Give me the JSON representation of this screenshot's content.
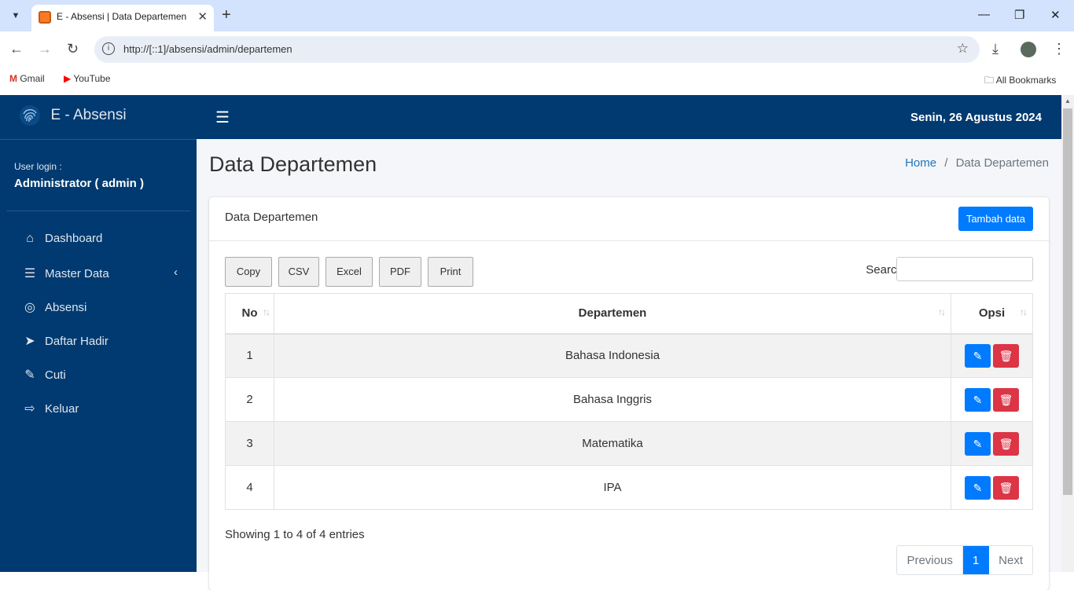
{
  "browser": {
    "tab_title": "E - Absensi | Data Departemen",
    "url": "http://[::1]/absensi/admin/departemen",
    "bookmarks": [
      {
        "label": "Gmail",
        "icon": "gmail-icon"
      },
      {
        "label": "YouTube",
        "icon": "youtube-icon"
      }
    ],
    "all_bookmarks": "All Bookmarks"
  },
  "sidebar": {
    "brand": "E - Absensi",
    "user_label": "User login :",
    "user_name": "Administrator ( admin )",
    "items": [
      {
        "label": "Dashboard",
        "icon": "home-icon"
      },
      {
        "label": "Master Data",
        "icon": "list-icon"
      },
      {
        "label": "Absensi",
        "icon": "fingerprint-icon"
      },
      {
        "label": "Daftar Hadir",
        "icon": "paper-plane-icon"
      },
      {
        "label": "Cuti",
        "icon": "edit-icon"
      },
      {
        "label": "Keluar",
        "icon": "sign-out-icon"
      }
    ]
  },
  "topnav": {
    "date": "Senin, 26 Agustus 2024"
  },
  "page": {
    "title": "Data Departemen",
    "breadcrumb_home": "Home",
    "breadcrumb_sep": "/",
    "breadcrumb_current": "Data Departemen"
  },
  "card": {
    "title": "Data Departemen",
    "add_button": "Tambah data",
    "export_buttons": [
      "Copy",
      "CSV",
      "Excel",
      "PDF",
      "Print"
    ],
    "search_label": "Search:",
    "search_value": ""
  },
  "table": {
    "headers": [
      "No",
      "Departemen",
      "Opsi"
    ],
    "rows": [
      {
        "no": "1",
        "departemen": "Bahasa Indonesia"
      },
      {
        "no": "2",
        "departemen": "Bahasa Inggris"
      },
      {
        "no": "3",
        "departemen": "Matematika"
      },
      {
        "no": "4",
        "departemen": "IPA"
      }
    ]
  },
  "footer": {
    "info": "Showing 1 to 4 of 4 entries",
    "prev": "Previous",
    "page": "1",
    "next": "Next"
  },
  "colors": {
    "sidebar": "#003a70",
    "primary": "#007bff",
    "danger": "#dc3545"
  }
}
